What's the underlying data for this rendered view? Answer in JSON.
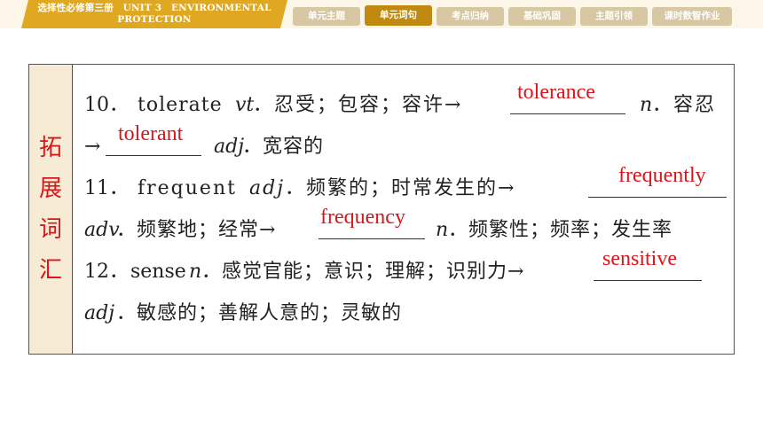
{
  "header": {
    "unit_line1": "选择性必修第三册　UNIT 3　ENVIRONMENTAL",
    "unit_line2": "PROTECTION",
    "nav": [
      {
        "label": "单元主题",
        "active": false
      },
      {
        "label": "单元词句",
        "active": true
      },
      {
        "label": "考点归纳",
        "active": false
      },
      {
        "label": "基础巩固",
        "active": false
      },
      {
        "label": "主题引领",
        "active": false
      },
      {
        "label": "课时数智作业",
        "active": false
      }
    ]
  },
  "side_title": [
    "拓",
    "展",
    "词",
    "汇"
  ],
  "entries": {
    "e10": {
      "num": "10．",
      "word": "tolerate",
      "pos": "vt",
      "meaning": "．忍受；包容；容许→",
      "derived1": "tolerance",
      "pos1": "n",
      "meaning1": "．容忍",
      "arrow2": "→",
      "derived2": "tolerant",
      "pos2": "adj",
      "meaning2": "．宽容的"
    },
    "e11": {
      "num": "11．",
      "word": "frequent",
      "pos": "adj",
      "meaning": "．频繁的；时常发生的→",
      "derived1": "frequently",
      "pos1": "adv",
      "meaning1": "．频繁地；经常→",
      "derived2": "frequency",
      "pos2": "n",
      "meaning2": "．频繁性；频率；发生率"
    },
    "e12": {
      "num": "12．",
      "word": "sense",
      "pos": "n",
      "meaning": "．感觉官能；意识；理解；识别力→",
      "derived1": "sensitive",
      "pos1": "adj",
      "meaning1": "．敏感的；善解人意的；灵敏的"
    }
  },
  "colors": {
    "answer": "#d9161b",
    "accent": "#e0a820",
    "nav_active": "#c08a10",
    "nav_idle": "#d7c7a3"
  }
}
